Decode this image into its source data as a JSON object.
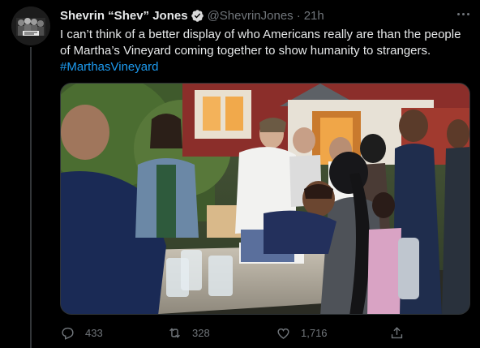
{
  "author": {
    "display_name": "Shevrin “Shev” Jones",
    "handle": "@ShevrinJones",
    "separator": "·",
    "time": "21h",
    "verified": true,
    "avatar_icon": "avatar-photo"
  },
  "tweet": {
    "text": "I can’t think of a better display of who Americans really are than the people of Martha’s Vineyard coming together to show humanity to strangers.",
    "hashtag": "#MarthasVineyard"
  },
  "media": {
    "icon": "photo"
  },
  "actions": {
    "reply_count": "433",
    "retweet_count": "328",
    "like_count": "1,716"
  },
  "colors": {
    "background": "#000000",
    "link": "#1d9bf0",
    "secondary_text": "#71767b",
    "primary_text": "#e7e9ea"
  }
}
